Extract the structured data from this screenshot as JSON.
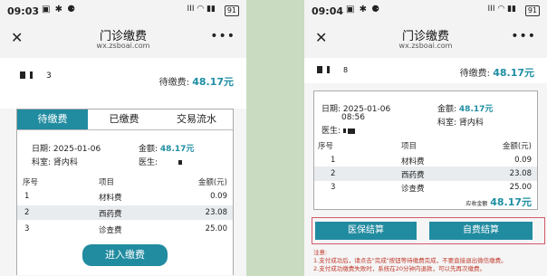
{
  "left": {
    "status_time": "09:03",
    "status_icons": "▣ ✱ ⚈",
    "status_right": "ⅠⅠⅠ ◠ ▮▮",
    "battery": "91",
    "nav_title": "门诊缴费",
    "nav_domain": "wx.zsboai.com",
    "close_glyph": "✕",
    "more_glyph": "•••",
    "user_suffix": "3",
    "tabs": [
      "待缴费",
      "已缴费",
      "交易流水"
    ],
    "date_label": "日期:",
    "date_value": "2025-01-06",
    "amount_label": "金额:",
    "amount_value": "48.17元",
    "dept_label": "科室:",
    "dept_value": "肾内科",
    "doctor_label": "医生:",
    "table_headers": [
      "序号",
      "项目",
      "金额(元)"
    ],
    "rows": [
      {
        "no": "1",
        "item": "材料费",
        "amount": "0.09"
      },
      {
        "no": "2",
        "item": "西药费",
        "amount": "23.08"
      },
      {
        "no": "3",
        "item": "诊查费",
        "amount": "25.00"
      }
    ],
    "pay_button": "进入缴费"
  },
  "right": {
    "status_time": "09:04",
    "status_icons": "▣ ✱ ⚈",
    "status_right": "ⅠⅠⅠ ◠ ▮▮",
    "battery": "91",
    "nav_title": "门诊缴费",
    "nav_domain": "wx.zsboai.com",
    "close_glyph": "✕",
    "more_glyph": "•••",
    "user_suffix": "8",
    "pending_label": "待缴费:",
    "pending_amount": "48.17元",
    "date_label": "日期:",
    "date_value": "2025-01-06",
    "time_value": "08:56",
    "amount_label": "金额:",
    "dept_label": "科室:",
    "dept_value": "肾内科",
    "doctor_label": "医生:",
    "table_headers": [
      "序号",
      "项目",
      "金额(元)"
    ],
    "rows": [
      {
        "no": "1",
        "item": "材料费",
        "amount": "0.09"
      },
      {
        "no": "2",
        "item": "西药费",
        "amount": "23.08"
      },
      {
        "no": "3",
        "item": "诊查费",
        "amount": "25.00"
      }
    ],
    "total_label": "应收金额",
    "total_value": "48.17元",
    "btn_insurance": "医保结算",
    "btn_self": "自费结算",
    "notice_title": "注意:",
    "notice_1": "1.支付成功后，请点击\"完成\"按钮等待缴费完成，不要直接退出微信缴费。",
    "notice_2": "2.支付成功缴费失败时，系统在20分钟内退款，可以先再次缴费。"
  },
  "colors": {
    "accent": "#218ba0",
    "notice": "#c0392b",
    "highlight": "#d35a6a"
  }
}
